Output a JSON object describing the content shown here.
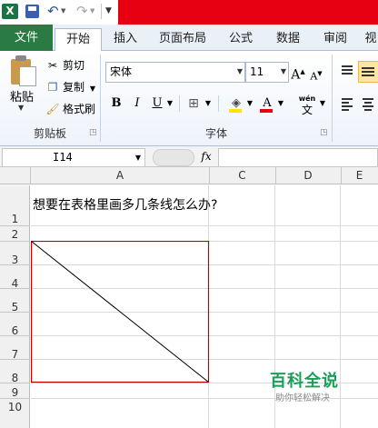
{
  "quick_access": {
    "app_icon": "X",
    "icons": [
      "excel-logo-icon",
      "save-icon",
      "undo-icon",
      "redo-icon",
      "customize-icon"
    ]
  },
  "tabs": [
    {
      "label": "文件",
      "active": false
    },
    {
      "label": "开始",
      "active": true
    },
    {
      "label": "插入",
      "active": false
    },
    {
      "label": "页面布局",
      "active": false
    },
    {
      "label": "公式",
      "active": false
    },
    {
      "label": "数据",
      "active": false
    },
    {
      "label": "审阅",
      "active": false
    },
    {
      "label": "视",
      "active": false
    }
  ],
  "ribbon": {
    "clipboard": {
      "paste_label": "粘贴",
      "cut_label": "剪切",
      "copy_label": "复制",
      "format_painter_label": "格式刷",
      "group_label": "剪贴板"
    },
    "font": {
      "font_name": "宋体",
      "font_size": "11",
      "grow_label": "A",
      "shrink_label": "A",
      "bold": "B",
      "italic": "I",
      "underline": "U",
      "font_color_label": "A",
      "wen_label": "wén",
      "wen_char": "文",
      "group_label": "字体"
    }
  },
  "formula_bar": {
    "name_box": "I14",
    "fx_label": "fx",
    "formula": ""
  },
  "sheet": {
    "columns": [
      "A",
      "C",
      "D",
      "E"
    ],
    "rows": [
      "1",
      "2",
      "3",
      "4",
      "5",
      "6",
      "7",
      "8",
      "9",
      "10"
    ],
    "cell_A1": "想要在表格里画多几条线怎么办?"
  },
  "watermark": {
    "title": "百科全说",
    "subtitle": "助你轻松解决"
  },
  "colors": {
    "title_red": "#e60012",
    "file_tab_green": "#2a7a44",
    "border_red": "#c00000",
    "watermark_green": "#1a9e5a"
  }
}
